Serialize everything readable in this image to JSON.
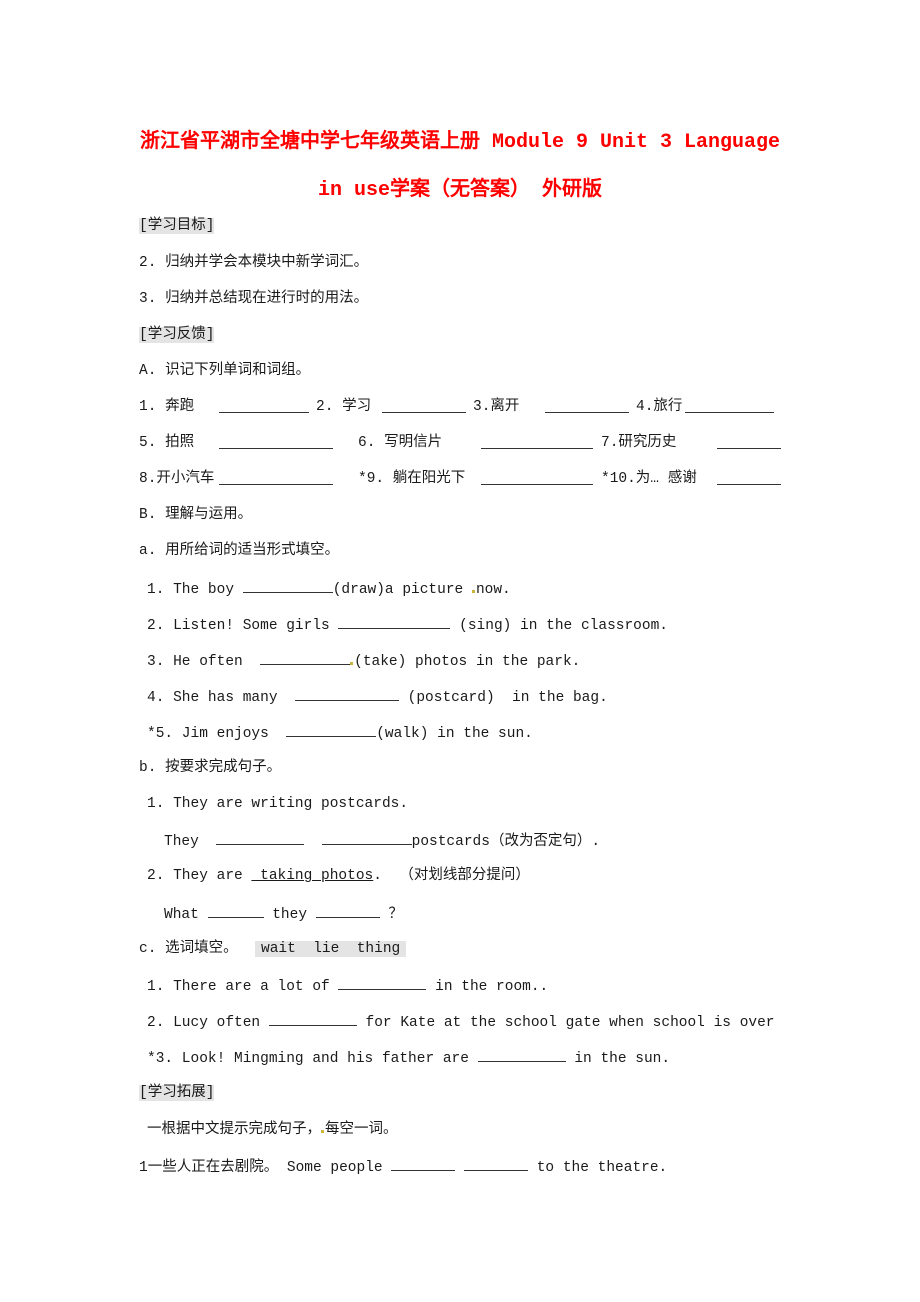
{
  "title": {
    "line1": "浙江省平湖市全塘中学七年级英语上册 Module 9 Unit 3 Language",
    "line2": "in use学案（无答案） 外研版"
  },
  "goals": {
    "header": "[学习目标]",
    "items": [
      "2. 归纳并学会本模块中新学词汇。",
      "3. 归纳并总结现在进行时的用法。"
    ]
  },
  "feedback": {
    "header": "[学习反馈]",
    "A": {
      "label": "A. 识记下列单词和词组。",
      "rows": [
        [
          {
            "n": "1. 奔跑"
          },
          {
            "n": "2. 学习"
          },
          {
            "n": "3.离开"
          },
          {
            "n": "4.旅行"
          }
        ],
        [
          {
            "n": "5. 拍照"
          },
          {
            "n": "6. 写明信片"
          },
          {
            "n": "7.研究历史"
          }
        ],
        [
          {
            "n": "8.开小汽车"
          },
          {
            "n": "*9. 躺在阳光下"
          },
          {
            "n": "*10.为… 感谢"
          }
        ]
      ]
    },
    "B": {
      "label": "B. 理解与运用。",
      "a": {
        "label": "a. 用所给词的适当形式填空。",
        "items": [
          {
            "pre": "1. The boy ",
            "post": "(draw)a picture ",
            "tail": "now."
          },
          {
            "pre": "2. Listen! Some girls ",
            "post": " (sing) in the classroom."
          },
          {
            "pre": "3. He often  ",
            "post": "(take) photos in the park."
          },
          {
            "pre": "4. She has many  ",
            "post": " (postcard)  in the bag."
          },
          {
            "pre": "*5. Jim enjoys  ",
            "post": "(walk) in the sun."
          }
        ]
      },
      "b": {
        "label": "b. 按要求完成句子。",
        "q1": {
          "sentence": "1. They are writing postcards.",
          "ans_pre": "They  ",
          "ans_post": "postcards（改为否定句）."
        },
        "q2": {
          "pre": "2. They are ",
          "underlined": " taking photos",
          "post": ".  （对划线部分提问）",
          "ans_pre": "What ",
          "ans_mid": " they ",
          "ans_post": " ？"
        }
      },
      "c": {
        "label": "c. 选词填空。",
        "words": "wait  lie  thing",
        "items": [
          {
            "pre": "1. There are a lot of ",
            "post": " in the room.."
          },
          {
            "pre": "2. Lucy often ",
            "post": " for Kate at the school gate when school is over"
          },
          {
            "pre": "*3. Look! Mingming and his father are ",
            "post": " in the sun."
          }
        ]
      }
    }
  },
  "extension": {
    "header": "[学习拓展]",
    "instruction_pre": "一根据中文提示完成句子，",
    "instruction_post": "每空一词。",
    "items": [
      {
        "pre": "1一些人正在去剧院。 Some people ",
        "post": " to the theatre."
      }
    ]
  }
}
